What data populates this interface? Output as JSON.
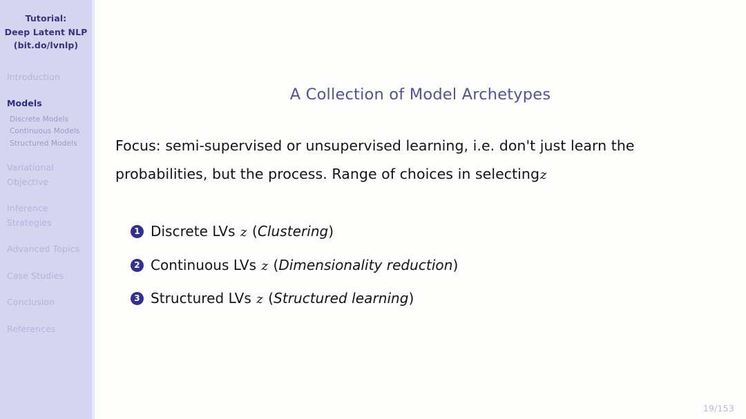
{
  "sidebar": {
    "title_lines": [
      "Tutorial:",
      "Deep Latent NLP",
      "(bit.do/lvnlp)"
    ],
    "items": [
      {
        "label": "Introduction",
        "active": false
      },
      {
        "label": "Models",
        "active": true
      },
      {
        "label": "Variational Objective",
        "active": false
      },
      {
        "label": "Inference Strategies",
        "active": false
      },
      {
        "label": "Advanced Topics",
        "active": false
      },
      {
        "label": "Case Studies",
        "active": false
      },
      {
        "label": "Conclusion",
        "active": false
      },
      {
        "label": "References",
        "active": false
      }
    ],
    "sub_items": [
      "Discrete Models",
      "Continuous Models",
      "Structured Models"
    ],
    "variational_line1": "Variational",
    "variational_line2": "Objective",
    "inference_line1": "Inference",
    "inference_line2": "Strategies"
  },
  "main": {
    "title": "A Collection of Model Archetypes",
    "paragraph_part1": "Focus: semi-supervised or unsupervised learning, i.e. don't just learn the probabilities, but the process. Range of choices in selecting",
    "paragraph_math": "z",
    "list": [
      {
        "number": "1",
        "prefix": "Discrete LVs",
        "math": "z",
        "open_paren": "(",
        "emphasis": "Clustering",
        "close_paren": ")"
      },
      {
        "number": "2",
        "prefix": "Continuous LVs",
        "math": "z",
        "open_paren": "(",
        "emphasis": "Dimensionality reduction",
        "close_paren": ")"
      },
      {
        "number": "3",
        "prefix": "Structured LVs",
        "math": "z",
        "open_paren": "(",
        "emphasis": "Structured learning",
        "close_paren": ")"
      }
    ]
  },
  "footer": {
    "page": "19/153"
  },
  "colors": {
    "sidebar_bg": "#d6d5f0",
    "sidebar_edge": "#e9e9f7",
    "nav_inactive": "#b3b2dd",
    "nav_active": "#2b2b85",
    "nav_sub": "#9a99c9",
    "title": "#53538f",
    "badge": "#2e3192",
    "body": "#141414",
    "page_number": "#b9b8de"
  }
}
